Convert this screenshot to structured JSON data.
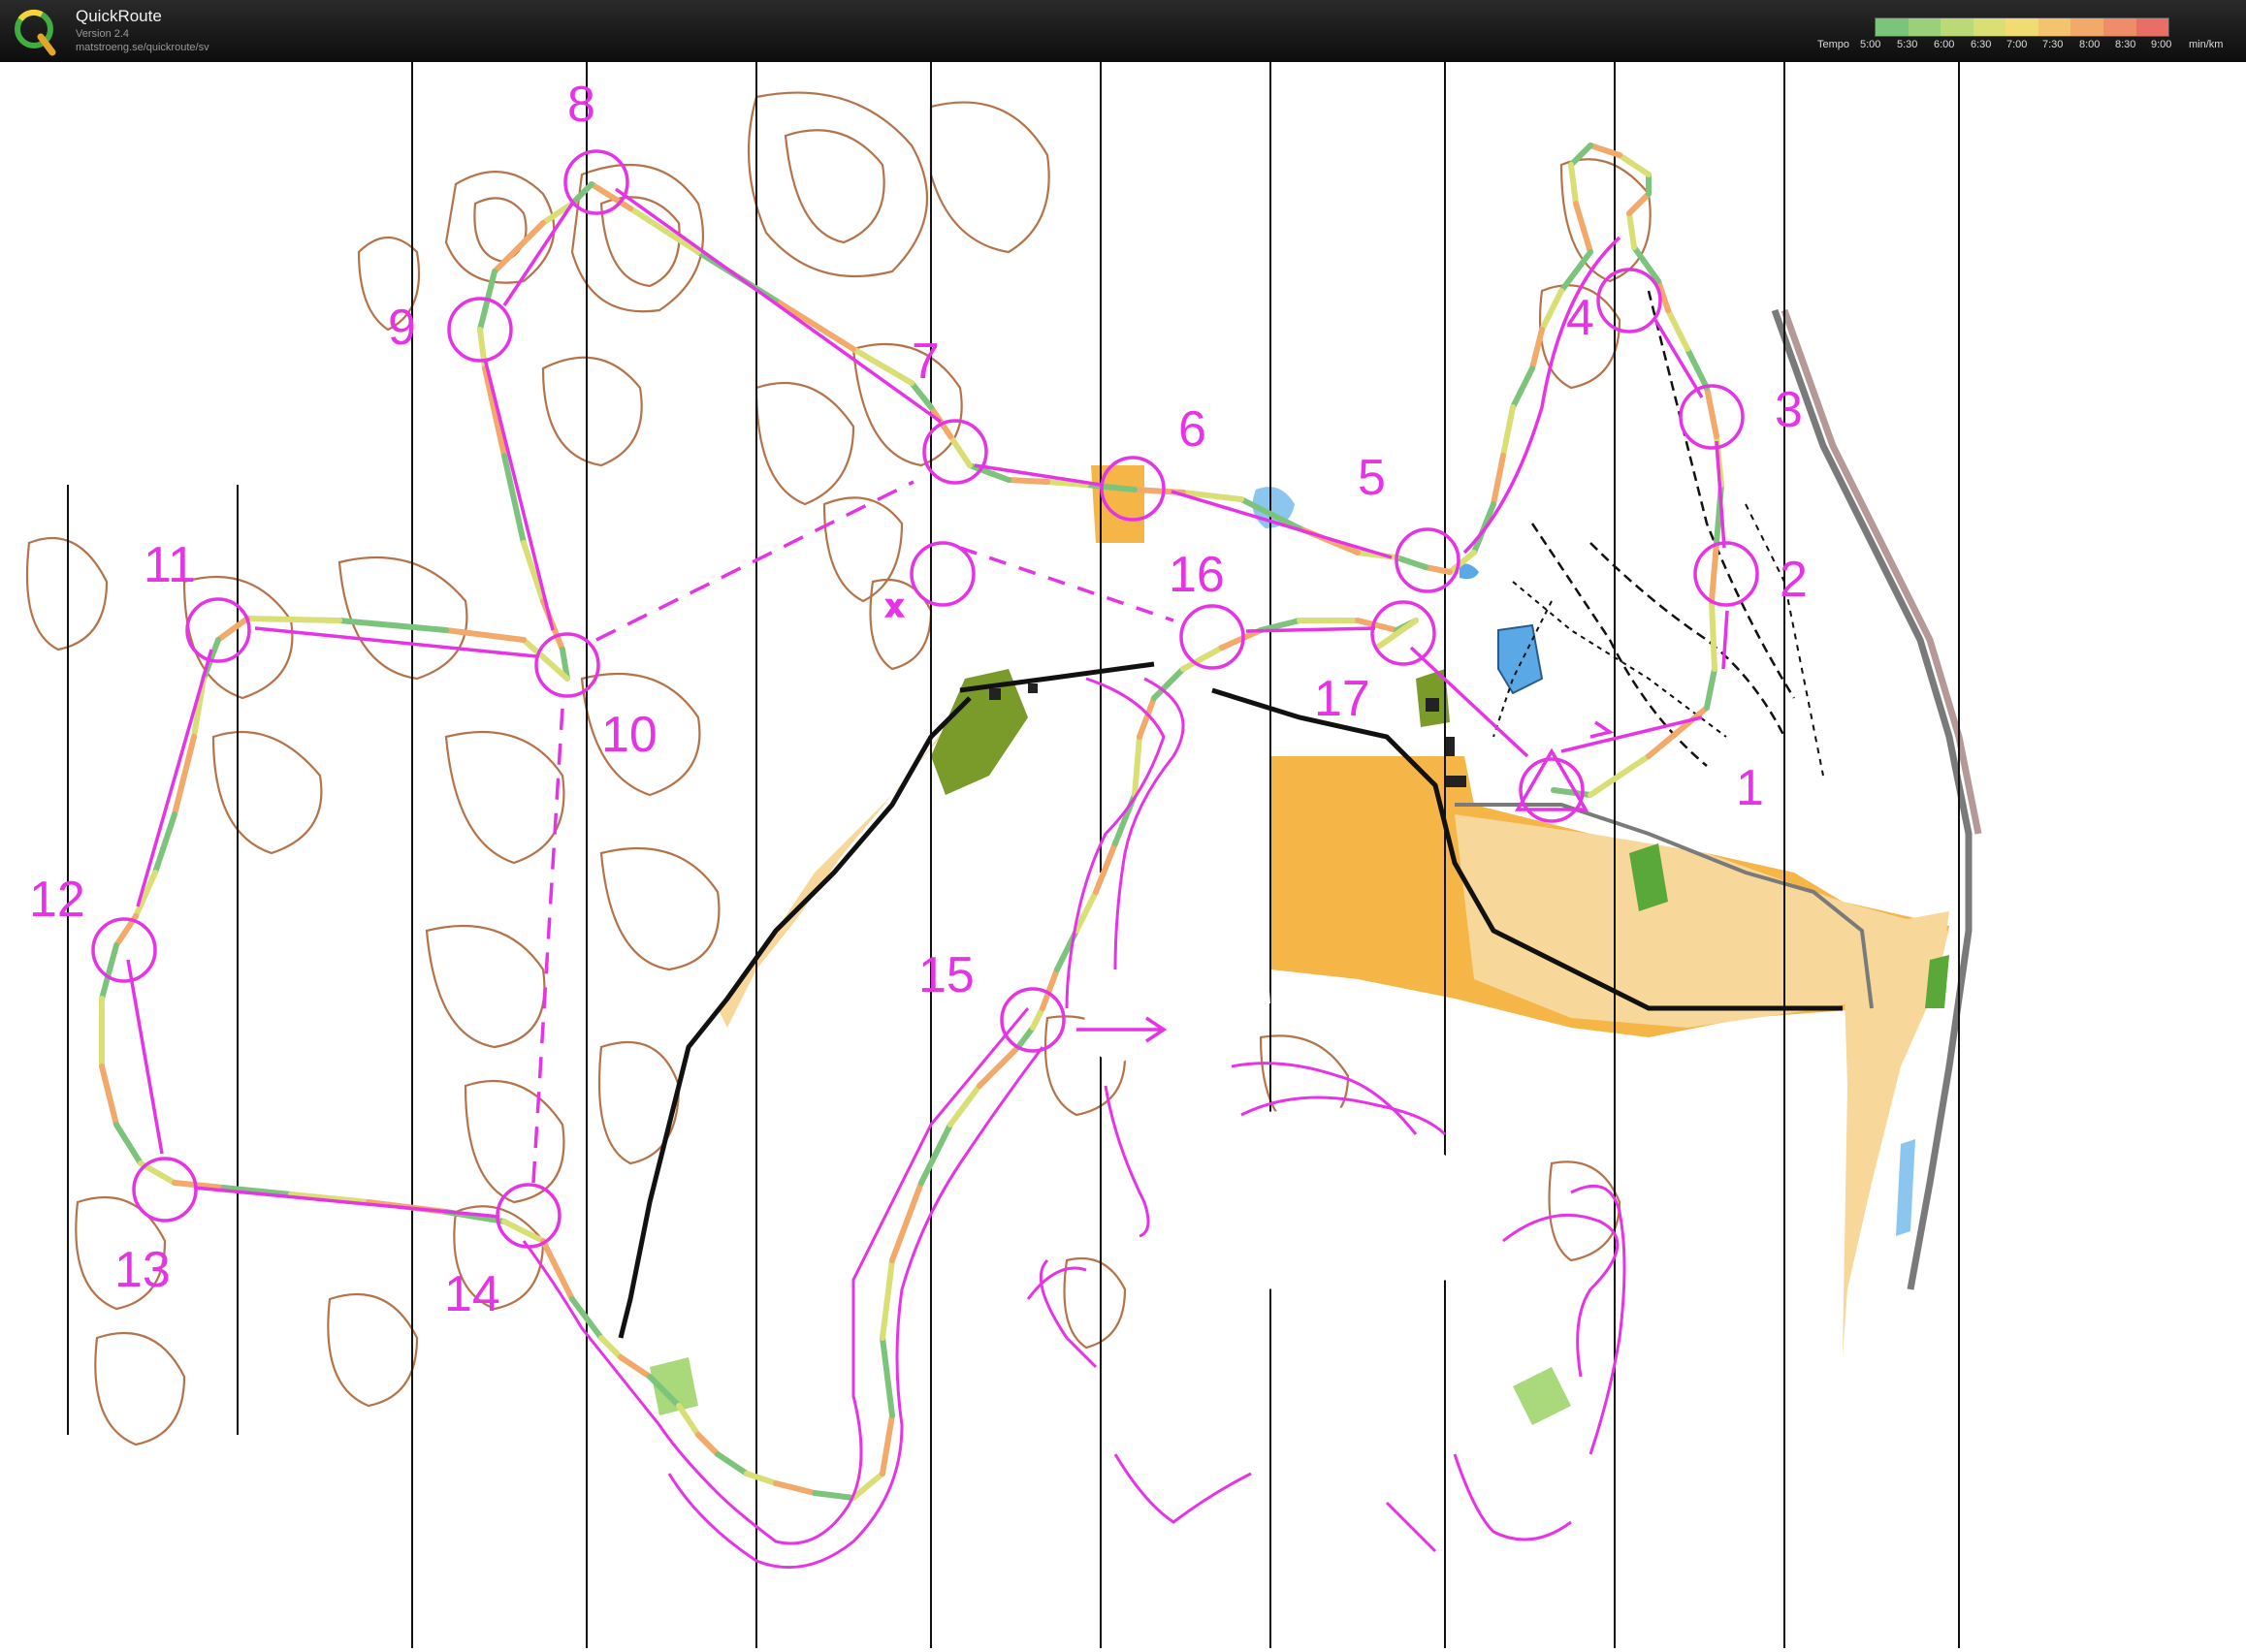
{
  "app": {
    "title": "QuickRoute",
    "version": "Version 2.4",
    "url": "matstroeng.se/quickroute/sv"
  },
  "tempo_legend": {
    "label": "Tempo",
    "ticks": [
      "5:00",
      "5:30",
      "6:00",
      "6:30",
      "7:00",
      "7:30",
      "8:00",
      "8:30",
      "9:00"
    ],
    "unit": "min/km",
    "gradient": [
      "#7cc47c",
      "#9bd07a",
      "#bcd977",
      "#d9df74",
      "#f0dc72",
      "#f3c36d",
      "#f2a96a",
      "#ee8d68",
      "#e86e66"
    ]
  },
  "course_color": "#e633e6",
  "route_color": "#8ab36a",
  "controls": [
    {
      "label": "1"
    },
    {
      "label": "2"
    },
    {
      "label": "3"
    },
    {
      "label": "4"
    },
    {
      "label": "5"
    },
    {
      "label": "6"
    },
    {
      "label": "7"
    },
    {
      "label": "8"
    },
    {
      "label": "9"
    },
    {
      "label": "10"
    },
    {
      "label": "11"
    },
    {
      "label": "12"
    },
    {
      "label": "13"
    },
    {
      "label": "14"
    },
    {
      "label": "15"
    },
    {
      "label": "16"
    },
    {
      "label": "17"
    }
  ]
}
